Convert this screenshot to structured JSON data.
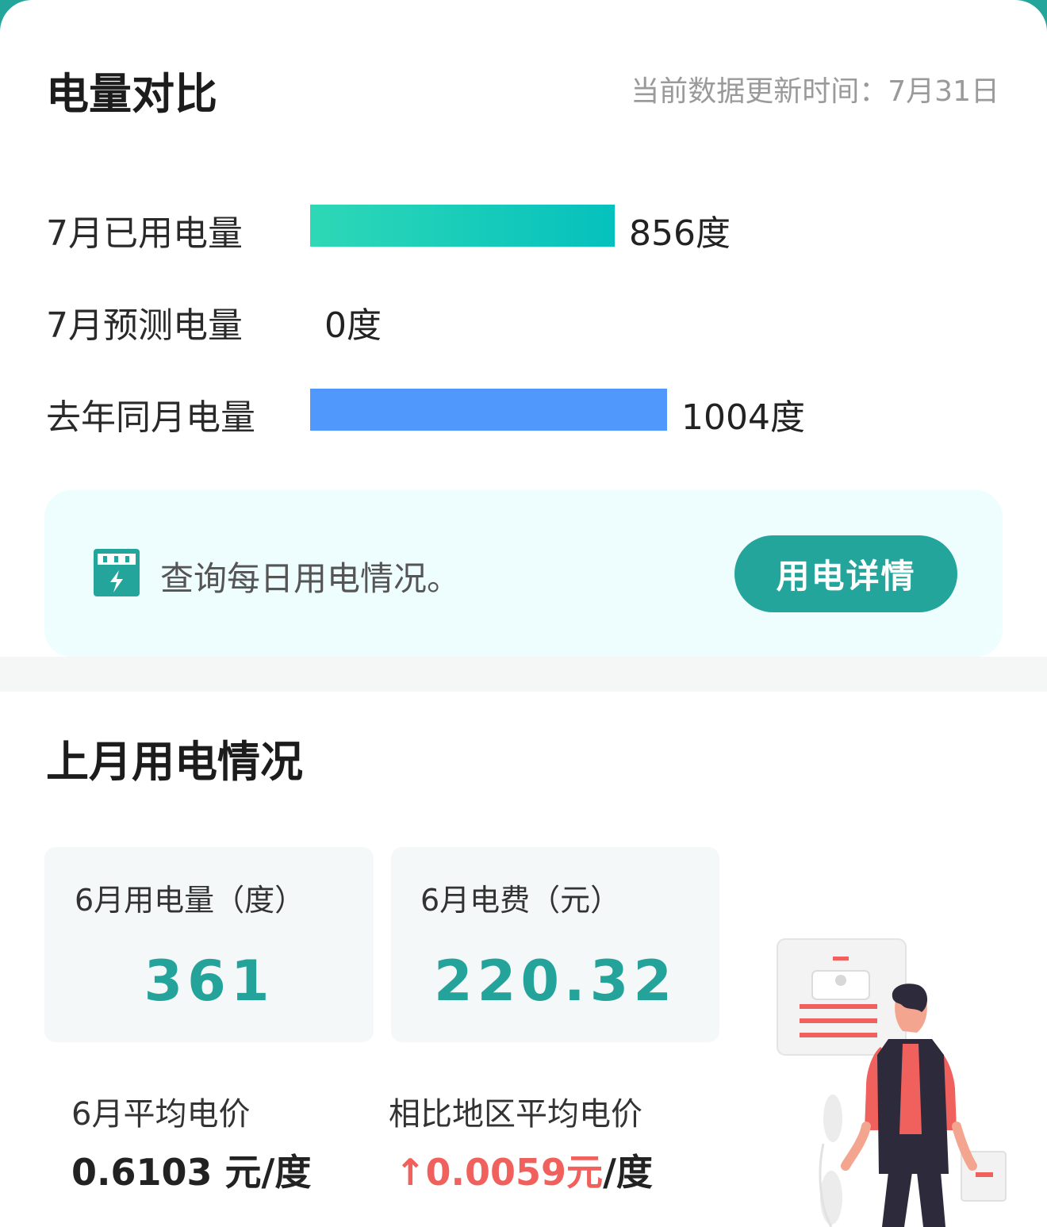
{
  "compare": {
    "title": "电量对比",
    "update_label": "当前数据更新时间：",
    "update_date": "7月31日",
    "rows": [
      {
        "label": "7月已用电量",
        "value": 856,
        "value_text": "856度"
      },
      {
        "label": "7月预测电量",
        "value": 0,
        "value_text": "0度"
      },
      {
        "label": "去年同月电量",
        "value": 1004,
        "value_text": "1004度"
      }
    ],
    "colors": {
      "used_start": "#2ed8b6",
      "used_end": "#05c1bd",
      "last_year": "#5198fd"
    },
    "promo": {
      "icon": "electric-meter-icon",
      "text": "查询每日用电情况。",
      "button": "用电详情"
    }
  },
  "last_month": {
    "title": "上月用电情况",
    "usage_label": "6月用电量（度）",
    "usage_value": "361",
    "fee_label": "6月电费（元）",
    "fee_value": "220.32",
    "avg_label": "6月平均电价",
    "avg_value": "0.6103 元/度",
    "compare_label": "相比地区平均电价",
    "compare_arrow": "↑",
    "compare_value": "0.0059元",
    "compare_unit": "/度",
    "illustration": "person-with-bill-illustration"
  }
}
